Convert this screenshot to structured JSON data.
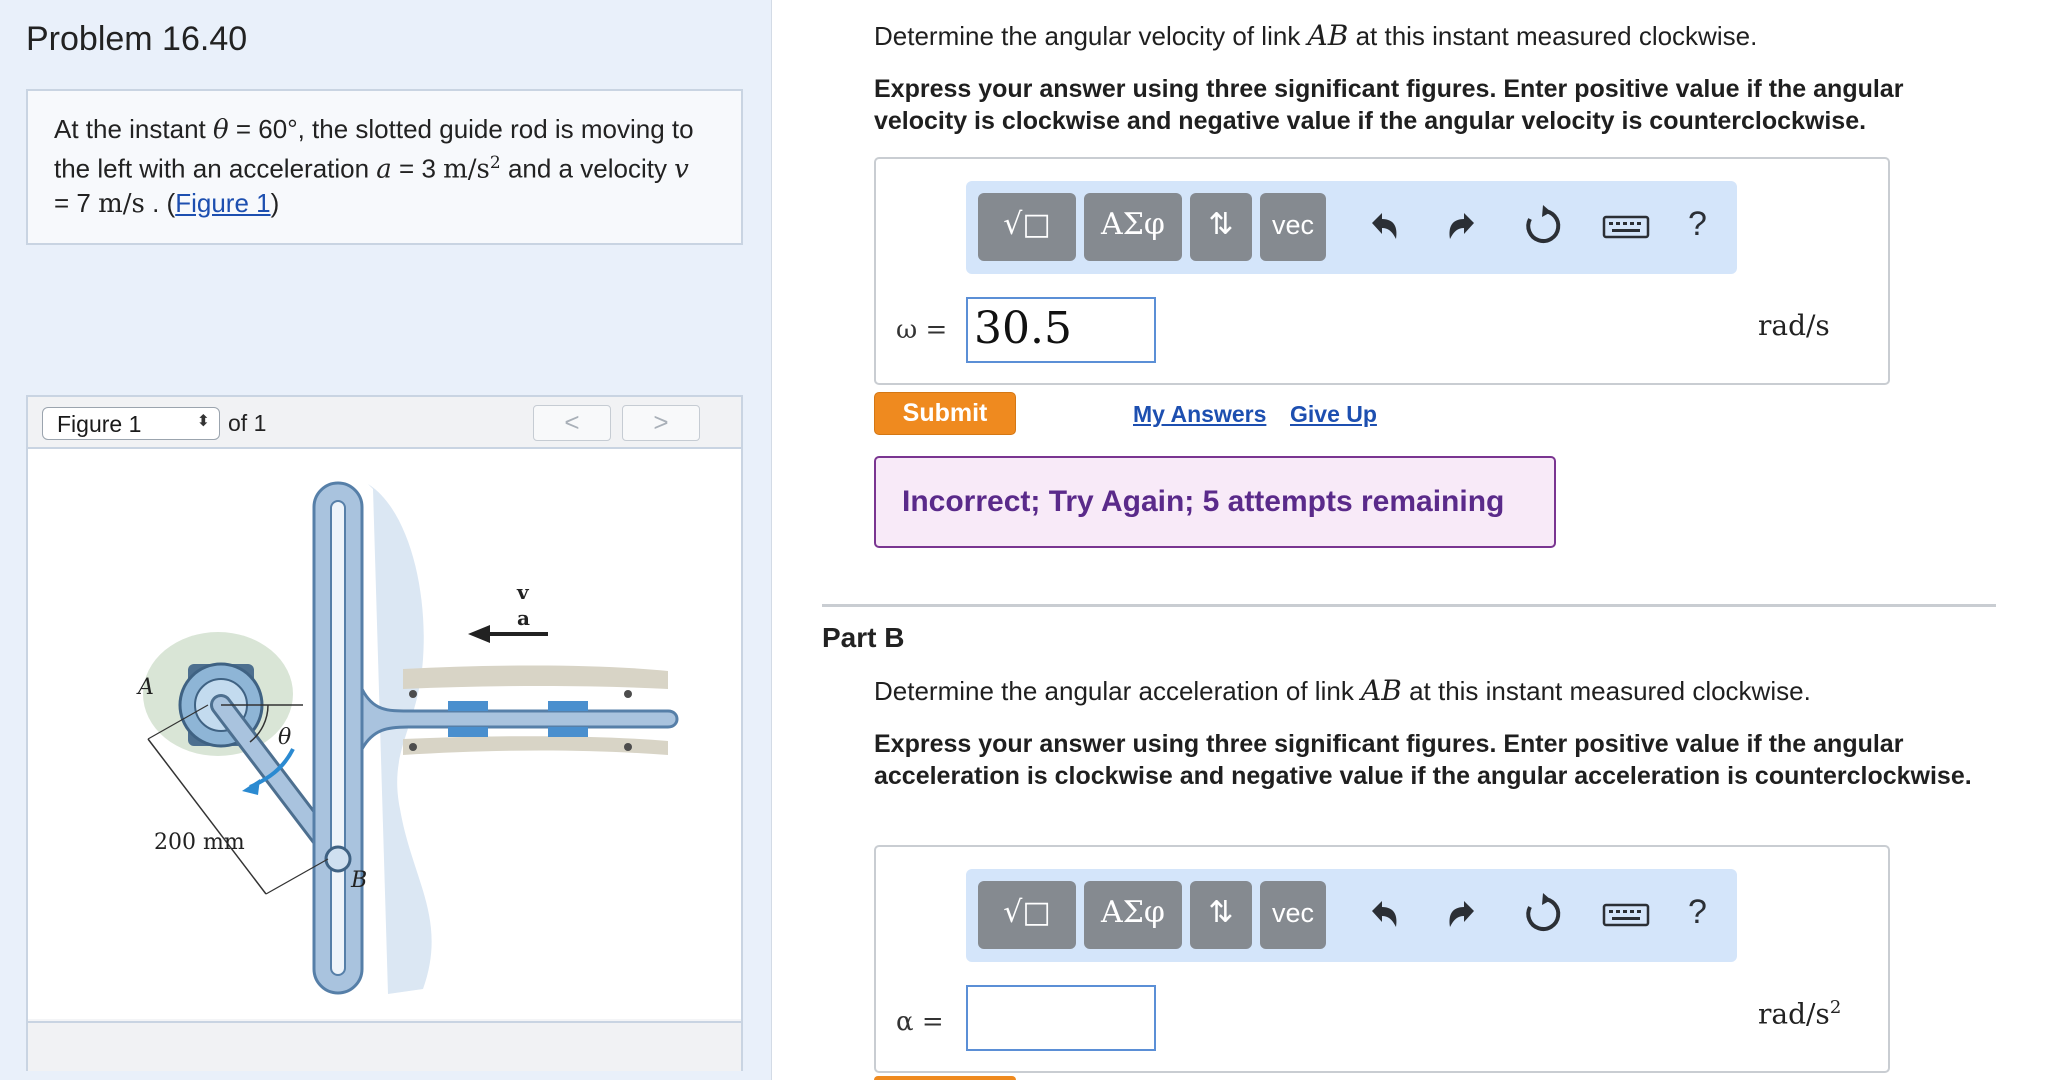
{
  "problem": {
    "title": "Problem 16.40",
    "text_prefix": "At the instant ",
    "theta_symbol": "θ",
    "text_theta_eq": " = 60°",
    "text_mid1": ", the slotted guide rod is moving to the left with an acceleration ",
    "a_symbol": "a",
    "text_a_eq": " = 3 ",
    "a_unit": "m/s",
    "a_unit_exp": "2",
    "text_mid2": " and a velocity ",
    "v_symbol": "v",
    "text_v_eq": " = 7 ",
    "v_unit": "m/s",
    "text_end": " . (",
    "figure_link": "Figure 1",
    "text_close": ")"
  },
  "figure": {
    "select_label": "Figure 1",
    "of_label": "of 1",
    "prev_label": "<",
    "next_label": ">",
    "labels": {
      "A": "A",
      "B": "B",
      "theta": "θ",
      "v": "v",
      "a": "a",
      "dim": "200 mm"
    },
    "colors": {
      "rod": "#a9c3de",
      "rod_edge": "#567fa8",
      "shadow": "#c9daef",
      "wall": "#cfdbe6",
      "motor": "#4d6f8f",
      "accent": "#2b8ad1"
    }
  },
  "partA": {
    "question_prefix": "Determine the angular velocity of link ",
    "link_name": "AB",
    "question_suffix": " at this instant measured clockwise.",
    "instructions": "Express your answer using three significant figures. Enter positive value if the angular velocity is clockwise and negative value if the angular velocity is counterclockwise.",
    "toolbar": {
      "templates": "√□",
      "greek": "ΑΣφ",
      "arrows": "⇅",
      "vec": "vec",
      "help": "?"
    },
    "var_label": "ω =",
    "input_value": "30.5",
    "unit": "rad/s",
    "submit_label": "Submit",
    "my_answers_label": "My Answers",
    "give_up_label": "Give Up",
    "feedback": "Incorrect; Try Again; 5 attempts remaining"
  },
  "partB": {
    "title": "Part B",
    "question_prefix": "Determine the angular acceleration of link ",
    "link_name": "AB",
    "question_suffix": " at this instant measured clockwise.",
    "instructions": "Express your answer using three significant figures. Enter positive value if the angular acceleration is clockwise and negative value if the angular acceleration is counterclockwise.",
    "toolbar": {
      "templates": "√□",
      "greek": "ΑΣφ",
      "arrows": "⇅",
      "vec": "vec",
      "help": "?"
    },
    "var_label": "α =",
    "input_value": "",
    "unit": "rad/s",
    "unit_exp": "2"
  },
  "colors": {
    "accent_orange": "#ef8a1f",
    "link_blue": "#1d4fb0",
    "feedback_bg": "#f8eaf8",
    "feedback_text": "#5a2a8a",
    "toolbar_bg": "#d4e5fa"
  }
}
